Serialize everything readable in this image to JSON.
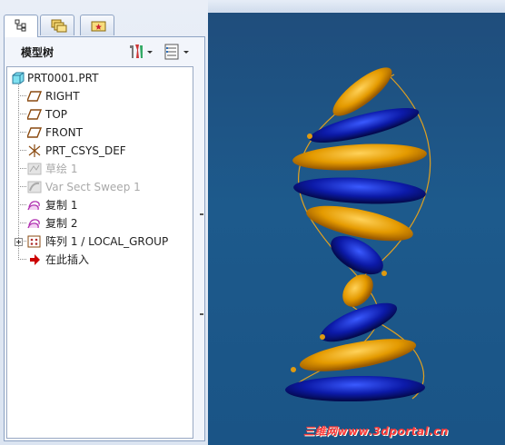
{
  "panel": {
    "title": "模型树",
    "tabs": [
      {
        "name": "model-tree-tab",
        "icon": "tree-icon"
      },
      {
        "name": "folder-browser-tab",
        "icon": "folders-icon"
      },
      {
        "name": "favorites-tab",
        "icon": "star-folder-icon"
      }
    ],
    "toolbar": [
      {
        "name": "tree-tools-button",
        "icon": "tools-icon"
      },
      {
        "name": "settings-button",
        "icon": "settings-list-icon"
      }
    ]
  },
  "tree": {
    "items": [
      {
        "label": "PRT0001.PRT",
        "icon": "part-icon",
        "dim": false,
        "level": 0
      },
      {
        "label": "RIGHT",
        "icon": "datum-plane-icon",
        "dim": false,
        "level": 1
      },
      {
        "label": "TOP",
        "icon": "datum-plane-icon",
        "dim": false,
        "level": 1
      },
      {
        "label": "FRONT",
        "icon": "datum-plane-icon",
        "dim": false,
        "level": 1
      },
      {
        "label": "PRT_CSYS_DEF",
        "icon": "csys-icon",
        "dim": false,
        "level": 1
      },
      {
        "label": "草绘 1",
        "icon": "sketch-icon",
        "dim": true,
        "level": 1
      },
      {
        "label": "Var Sect Sweep 1",
        "icon": "sweep-icon",
        "dim": true,
        "level": 1
      },
      {
        "label": "复制 1",
        "icon": "copy-surface-icon",
        "dim": false,
        "level": 1
      },
      {
        "label": "复制 2",
        "icon": "copy-surface-icon",
        "dim": false,
        "level": 1
      },
      {
        "label": "阵列 1 / LOCAL_GROUP",
        "icon": "pattern-icon",
        "dim": false,
        "level": 1,
        "expandable": true
      },
      {
        "label": "在此插入",
        "icon": "insert-here-arrow-icon",
        "dim": false,
        "level": 1
      }
    ]
  },
  "watermark": "三维网www.3dportal.cn",
  "colors": {
    "viewport_bg": "#1d5a8c",
    "gold": "#e8a000",
    "blue": "#0a1a9a",
    "helix_line": "#e0a020",
    "insert_arrow": "#cc0000"
  }
}
